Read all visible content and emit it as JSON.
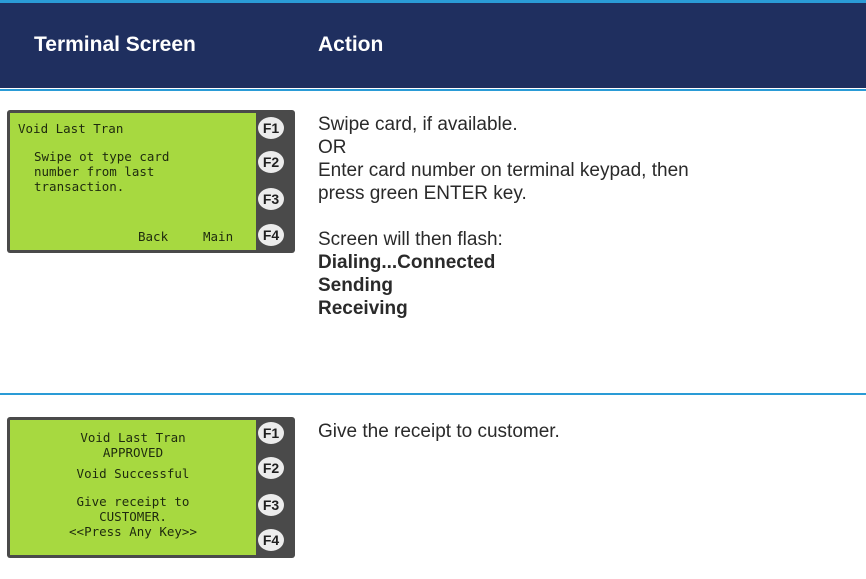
{
  "header": {
    "col1": "Terminal Screen",
    "col2": "Action"
  },
  "colors": {
    "header_bg": "#1f2f5f",
    "accent_line": "#2a9bd6",
    "lcd_green": "#a7d940",
    "terminal_body": "#4a4a4a"
  },
  "fkeys": [
    "F1",
    "F2",
    "F3",
    "F4"
  ],
  "row1": {
    "screen": {
      "title": "Void Last Tran",
      "line1": "Swipe ot type card",
      "line2": "number from last",
      "line3": "transaction.",
      "soft_back": "Back",
      "soft_main": "Main"
    },
    "action": {
      "line1": "Swipe card, if available.",
      "line2": "OR",
      "line3": "Enter card number on terminal keypad, then",
      "line4": "press green ENTER key.",
      "line5": "Screen will then flash:",
      "bold1": "Dialing...Connected",
      "bold2": "Sending",
      "bold3": "Receiving"
    }
  },
  "row2": {
    "screen": {
      "line1": "Void Last Tran",
      "line2": "APPROVED",
      "line3": "Void Successful",
      "line4": "Give receipt to",
      "line5": "CUSTOMER.",
      "line6": "<<Press Any Key>>"
    },
    "action": {
      "line1": "Give the receipt to customer."
    }
  }
}
